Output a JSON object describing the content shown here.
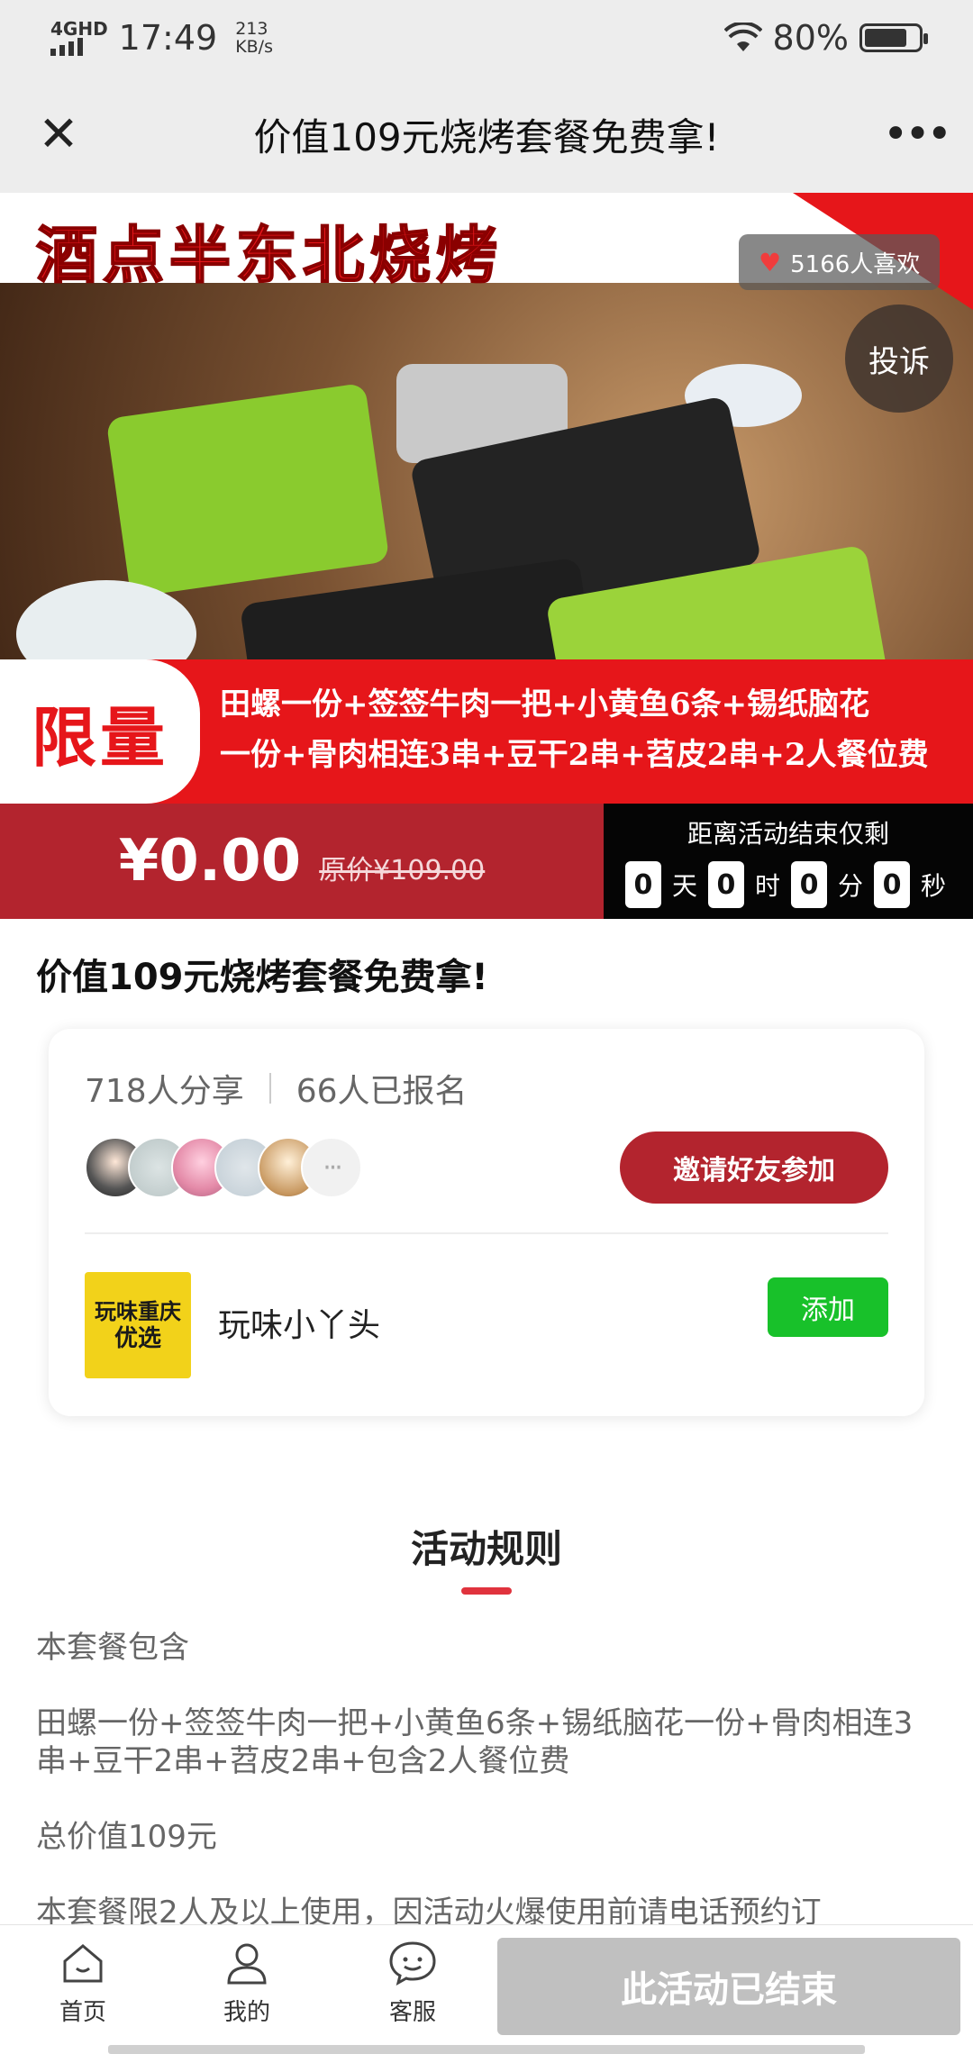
{
  "status": {
    "network": "4GHD",
    "time": "17:49",
    "speed_value": "213",
    "speed_unit": "KB/s",
    "battery": "80%",
    "battery_level": 0.8
  },
  "nav": {
    "close_icon": "close-icon",
    "title": "价值109元烧烤套餐免费拿!",
    "more_icon": "more-icon"
  },
  "hero": {
    "brand": "酒点半东北烧烤",
    "likes": "5166人喜欢",
    "complain": "投诉",
    "promo_tag": "限量",
    "promo_line1": "田螺一份+签签牛肉一把+小黄鱼6条+锡纸脑花",
    "promo_line2": "一份+骨肉相连3串+豆干2串+苕皮2串+2人餐位费"
  },
  "price": {
    "current": "¥0.00",
    "original": "原价¥109.00",
    "countdown_label": "距离活动结束仅剩",
    "days": "0",
    "days_unit": "天",
    "hours": "0",
    "hours_unit": "时",
    "minutes": "0",
    "minutes_unit": "分",
    "seconds": "0",
    "seconds_unit": "秒"
  },
  "main": {
    "title": "价值109元烧烤套餐免费拿!"
  },
  "card": {
    "shares": "718人分享",
    "signed_up": "66人已报名",
    "more_avatars": "···",
    "invite_button": "邀请好友参加",
    "shop_logo_line1": "玩味重庆",
    "shop_logo_line2": "优选",
    "shop_name": "玩味小丫头",
    "add_button": "添加"
  },
  "rules": {
    "heading": "活动规则",
    "p1": "本套餐包含",
    "p2": "田螺一份+签签牛肉一把+小黄鱼6条+锡纸脑花一份+骨肉相连3串+豆干2串+苕皮2串+包含2人餐位费",
    "p3": "总价值109元",
    "p4": "本套餐限2人及以上使用，因活动火爆使用前请电话预约订"
  },
  "bottom": {
    "tab_home": "首页",
    "tab_me": "我的",
    "tab_service": "客服",
    "ended_button": "此活动已结束"
  },
  "colors": {
    "primary_red": "#b3242e",
    "banner_red": "#e6161a",
    "add_green": "#18c12a",
    "disabled_gray": "#c0c0c0"
  }
}
